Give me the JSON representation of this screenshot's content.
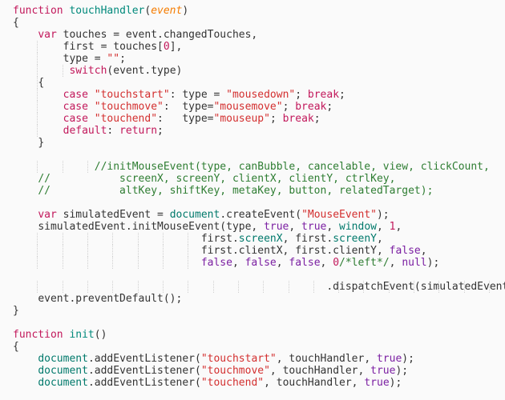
{
  "editor": {
    "colors": {
      "background": "#fafafa",
      "keyword": "#c2185b",
      "function_name": "#00897b",
      "string": "#d32f2f",
      "boolean": "#7b1fa2",
      "parameter": "#f57c00",
      "comment": "#2e7d32",
      "text": "#333333"
    },
    "lines": [
      {
        "indent": 0,
        "guides": 0,
        "tokens": [
          [
            "kw",
            "function"
          ],
          [
            "plain",
            " "
          ],
          [
            "fn",
            "touchHandler"
          ],
          [
            "plain",
            "("
          ],
          [
            "param",
            "event"
          ],
          [
            "plain",
            ")"
          ]
        ]
      },
      {
        "indent": 0,
        "guides": 0,
        "tokens": [
          [
            "plain",
            "{"
          ]
        ]
      },
      {
        "indent": 4,
        "guides": 0,
        "tokens": [
          [
            "kw",
            "var"
          ],
          [
            "plain",
            " touches = event.changedTouches,"
          ]
        ]
      },
      {
        "indent": 8,
        "guides": 1,
        "tokens": [
          [
            "plain",
            "first = touches["
          ],
          [
            "num",
            "0"
          ],
          [
            "plain",
            "],"
          ]
        ]
      },
      {
        "indent": 8,
        "guides": 1,
        "tokens": [
          [
            "plain",
            "type = "
          ],
          [
            "str",
            "\"\""
          ],
          [
            "plain",
            ";"
          ]
        ]
      },
      {
        "indent": 9,
        "guides": 2,
        "tokens": [
          [
            "kw",
            "switch"
          ],
          [
            "plain",
            "(event.type)"
          ]
        ]
      },
      {
        "indent": 4,
        "guides": 1,
        "tokens": [
          [
            "plain",
            "{"
          ]
        ]
      },
      {
        "indent": 8,
        "guides": 1,
        "tokens": [
          [
            "kw",
            "case"
          ],
          [
            "plain",
            " "
          ],
          [
            "str",
            "\"touchstart\""
          ],
          [
            "plain",
            ": type = "
          ],
          [
            "str",
            "\"mousedown\""
          ],
          [
            "plain",
            "; "
          ],
          [
            "kw",
            "break"
          ],
          [
            "plain",
            ";"
          ]
        ]
      },
      {
        "indent": 8,
        "guides": 1,
        "tokens": [
          [
            "kw",
            "case"
          ],
          [
            "plain",
            " "
          ],
          [
            "str",
            "\"touchmove\""
          ],
          [
            "plain",
            ":  type="
          ],
          [
            "str",
            "\"mousemove\""
          ],
          [
            "plain",
            "; "
          ],
          [
            "kw",
            "break"
          ],
          [
            "plain",
            ";"
          ]
        ]
      },
      {
        "indent": 8,
        "guides": 1,
        "tokens": [
          [
            "kw",
            "case"
          ],
          [
            "plain",
            " "
          ],
          [
            "str",
            "\"touchend\""
          ],
          [
            "plain",
            ":   type="
          ],
          [
            "str",
            "\"mouseup\""
          ],
          [
            "plain",
            "; "
          ],
          [
            "kw",
            "break"
          ],
          [
            "plain",
            ";"
          ]
        ]
      },
      {
        "indent": 8,
        "guides": 1,
        "tokens": [
          [
            "kw",
            "default"
          ],
          [
            "plain",
            ": "
          ],
          [
            "kw",
            "return"
          ],
          [
            "plain",
            ";"
          ]
        ]
      },
      {
        "indent": 4,
        "guides": 0,
        "tokens": [
          [
            "plain",
            "}"
          ]
        ]
      },
      {
        "indent": 0,
        "guides": 0,
        "tokens": []
      },
      {
        "indent": 13,
        "guides": 3,
        "tokens": [
          [
            "cmt",
            "//initMouseEvent(type, canBubble, cancelable, view, clickCount,"
          ]
        ]
      },
      {
        "indent": 4,
        "guides": 0,
        "tokens": [
          [
            "cmt",
            "//           screenX, screenY, clientX, clientY, ctrlKey,"
          ]
        ]
      },
      {
        "indent": 4,
        "guides": 0,
        "tokens": [
          [
            "cmt",
            "//           altKey, shiftKey, metaKey, button, relatedTarget);"
          ]
        ]
      },
      {
        "indent": 0,
        "guides": 0,
        "tokens": []
      },
      {
        "indent": 4,
        "guides": 0,
        "tokens": [
          [
            "kw",
            "var"
          ],
          [
            "plain",
            " simulatedEvent = "
          ],
          [
            "prop",
            "document"
          ],
          [
            "plain",
            ".createEvent("
          ],
          [
            "str",
            "\"MouseEvent\""
          ],
          [
            "plain",
            ");"
          ]
        ]
      },
      {
        "indent": 4,
        "guides": 0,
        "tokens": [
          [
            "plain",
            "simulatedEvent.initMouseEvent(type, "
          ],
          [
            "bool",
            "true"
          ],
          [
            "plain",
            ", "
          ],
          [
            "bool",
            "true"
          ],
          [
            "plain",
            ", "
          ],
          [
            "prop",
            "window"
          ],
          [
            "plain",
            ", "
          ],
          [
            "num",
            "1"
          ],
          [
            "plain",
            ","
          ]
        ]
      },
      {
        "indent": 30,
        "guides": 7,
        "tokens": [
          [
            "plain",
            "first."
          ],
          [
            "prop",
            "screenX"
          ],
          [
            "plain",
            ", first."
          ],
          [
            "prop",
            "screenY"
          ],
          [
            "plain",
            ","
          ]
        ]
      },
      {
        "indent": 30,
        "guides": 7,
        "tokens": [
          [
            "plain",
            "first.clientX, first.clientY, "
          ],
          [
            "bool",
            "false"
          ],
          [
            "plain",
            ","
          ]
        ]
      },
      {
        "indent": 30,
        "guides": 7,
        "tokens": [
          [
            "bool",
            "false"
          ],
          [
            "plain",
            ", "
          ],
          [
            "bool",
            "false"
          ],
          [
            "plain",
            ", "
          ],
          [
            "bool",
            "false"
          ],
          [
            "plain",
            ", "
          ],
          [
            "num",
            "0"
          ],
          [
            "cmt",
            "/*left*/"
          ],
          [
            "plain",
            ", "
          ],
          [
            "bool",
            "null"
          ],
          [
            "plain",
            ");"
          ]
        ]
      },
      {
        "indent": 0,
        "guides": 0,
        "tokens": []
      },
      {
        "indent": 50,
        "guides": 19,
        "tokens": [
          [
            "plain",
            ".dispatchEvent(simulatedEvent);"
          ]
        ]
      },
      {
        "indent": 4,
        "guides": 0,
        "tokens": [
          [
            "plain",
            "event.preventDefault();"
          ]
        ]
      },
      {
        "indent": 0,
        "guides": 0,
        "tokens": [
          [
            "plain",
            "}"
          ]
        ]
      },
      {
        "indent": 0,
        "guides": 0,
        "tokens": []
      },
      {
        "indent": 0,
        "guides": 0,
        "tokens": [
          [
            "kw",
            "function"
          ],
          [
            "plain",
            " "
          ],
          [
            "fn",
            "init"
          ],
          [
            "plain",
            "()"
          ]
        ]
      },
      {
        "indent": 0,
        "guides": 0,
        "tokens": [
          [
            "plain",
            "{"
          ]
        ]
      },
      {
        "indent": 4,
        "guides": 0,
        "tokens": [
          [
            "prop",
            "document"
          ],
          [
            "plain",
            ".addEventListener("
          ],
          [
            "str",
            "\"touchstart\""
          ],
          [
            "plain",
            ", touchHandler, "
          ],
          [
            "bool",
            "true"
          ],
          [
            "plain",
            ");"
          ]
        ]
      },
      {
        "indent": 4,
        "guides": 0,
        "tokens": [
          [
            "prop",
            "document"
          ],
          [
            "plain",
            ".addEventListener("
          ],
          [
            "str",
            "\"touchmove\""
          ],
          [
            "plain",
            ", touchHandler, "
          ],
          [
            "bool",
            "true"
          ],
          [
            "plain",
            ");"
          ]
        ]
      },
      {
        "indent": 4,
        "guides": 0,
        "tokens": [
          [
            "prop",
            "document"
          ],
          [
            "plain",
            ".addEventListener("
          ],
          [
            "str",
            "\"touchend\""
          ],
          [
            "plain",
            ", touchHandler, "
          ],
          [
            "bool",
            "true"
          ],
          [
            "plain",
            ");"
          ]
        ]
      }
    ]
  }
}
